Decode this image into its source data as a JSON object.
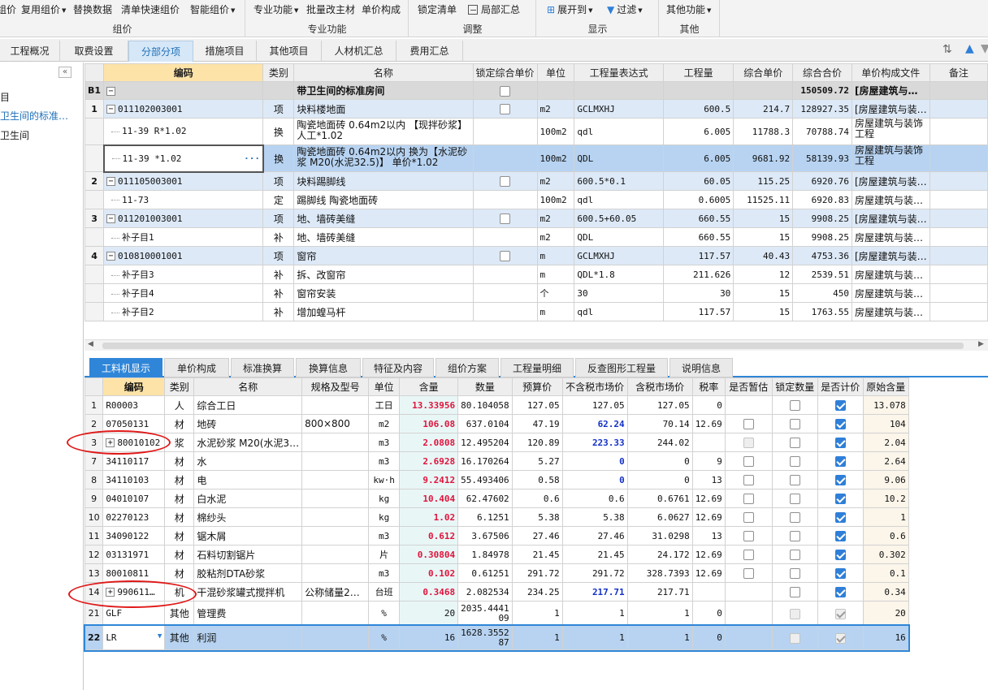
{
  "ribbon": {
    "btns": [
      "组价",
      "复用组价",
      "替换数据",
      "清单快速组价",
      "智能组价",
      "专业功能",
      "批量改主材",
      "单价构成",
      "锁定清单",
      "局部汇总",
      "展开到",
      "过滤",
      "其他功能"
    ],
    "groups": [
      "组价",
      "专业功能",
      "调整",
      "显示",
      "其他"
    ]
  },
  "tabs": [
    "工程概况",
    "取费设置",
    "分部分项",
    "措施项目",
    "其他项目",
    "人材机汇总",
    "费用汇总"
  ],
  "left": {
    "items": [
      "目",
      "卫生间的标准…",
      "卫生间"
    ]
  },
  "top": {
    "headers": [
      "编码",
      "类别",
      "名称",
      "锁定综合单价",
      "单位",
      "工程量表达式",
      "工程量",
      "综合单价",
      "综合合价",
      "单价构成文件",
      "备注"
    ],
    "rows": [
      {
        "no": "B1",
        "code": "",
        "type": "",
        "name": "带卫生间的标准房间",
        "lock": true,
        "unit": "",
        "expr": "",
        "qty": "",
        "price": "",
        "total": "150509.72",
        "file": "[房屋建筑与…"
      },
      {
        "no": "1",
        "code": "011102003001",
        "type": "项",
        "name": "块料楼地面",
        "lock": true,
        "unit": "m2",
        "expr": "GCLMXHJ",
        "qty": "600.5",
        "price": "214.7",
        "total": "128927.35",
        "file": "[房屋建筑与装…"
      },
      {
        "no": "",
        "code": "11-39 R*1.02",
        "type": "换",
        "name": "陶瓷地面砖 0.64m2以内 【现拌砂浆】 人工*1.02",
        "lock": false,
        "unit": "100m2",
        "expr": "qdl",
        "qty": "6.005",
        "price": "11788.3",
        "total": "70788.74",
        "file": "房屋建筑与装饰工程"
      },
      {
        "no": "",
        "code": "11-39 *1.02",
        "type": "换",
        "name": "陶瓷地面砖 0.64m2以内 换为【水泥砂浆 M20(水泥32.5)】 单价*1.02",
        "lock": false,
        "unit": "100m2",
        "expr": "QDL",
        "qty": "6.005",
        "price": "9681.92",
        "total": "58139.93",
        "file": "房屋建筑与装饰工程",
        "dots": "···"
      },
      {
        "no": "2",
        "code": "011105003001",
        "type": "项",
        "name": "块料踢脚线",
        "lock": true,
        "unit": "m2",
        "expr": "600.5*0.1",
        "qty": "60.05",
        "price": "115.25",
        "total": "6920.76",
        "file": "[房屋建筑与装…"
      },
      {
        "no": "",
        "code": "11-73",
        "type": "定",
        "name": "踢脚线 陶瓷地面砖",
        "lock": false,
        "unit": "100m2",
        "expr": "qdl",
        "qty": "0.6005",
        "price": "11525.11",
        "total": "6920.83",
        "file": "房屋建筑与装…"
      },
      {
        "no": "3",
        "code": "011201003001",
        "type": "项",
        "name": "地、墙砖美缝",
        "lock": true,
        "unit": "m2",
        "expr": "600.5+60.05",
        "qty": "660.55",
        "price": "15",
        "total": "9908.25",
        "file": "[房屋建筑与装…"
      },
      {
        "no": "",
        "code": "补子目1",
        "type": "补",
        "name": "地、墙砖美缝",
        "lock": false,
        "unit": "m2",
        "expr": "QDL",
        "qty": "660.55",
        "price": "15",
        "total": "9908.25",
        "file": "房屋建筑与装…"
      },
      {
        "no": "4",
        "code": "010810001001",
        "type": "项",
        "name": "窗帘",
        "lock": true,
        "unit": "m",
        "expr": "GCLMXHJ",
        "qty": "117.57",
        "price": "40.43",
        "total": "4753.36",
        "file": "[房屋建筑与装…"
      },
      {
        "no": "",
        "code": "补子目3",
        "type": "补",
        "name": "拆、改窗帘",
        "lock": false,
        "unit": "m",
        "expr": "QDL*1.8",
        "qty": "211.626",
        "price": "12",
        "total": "2539.51",
        "file": "房屋建筑与装…"
      },
      {
        "no": "",
        "code": "补子目4",
        "type": "补",
        "name": "窗帘安装",
        "lock": false,
        "unit": "个",
        "expr": "30",
        "qty": "30",
        "price": "15",
        "total": "450",
        "file": "房屋建筑与装…"
      },
      {
        "no": "",
        "code": "补子目2",
        "type": "补",
        "name": "增加蝗马杆",
        "lock": false,
        "unit": "m",
        "expr": "qdl",
        "qty": "117.57",
        "price": "15",
        "total": "1763.55",
        "file": "房屋建筑与装…"
      }
    ]
  },
  "btabs": [
    "工料机显示",
    "单价构成",
    "标准换算",
    "换算信息",
    "特征及内容",
    "组价方案",
    "工程量明细",
    "反查图形工程量",
    "说明信息"
  ],
  "bottom": {
    "headers": [
      "编码",
      "类别",
      "名称",
      "规格及型号",
      "单位",
      "含量",
      "数量",
      "预算价",
      "不含税市场价",
      "含税市场价",
      "税率",
      "是否暂估",
      "锁定数量",
      "是否计价",
      "原始含量"
    ],
    "rows": [
      {
        "no": "1",
        "code": "R00003",
        "type": "人",
        "name": "综合工日",
        "spec": "",
        "unit": "工日",
        "content": "13.33956",
        "qty": "80.104058",
        "budget": "127.05",
        "mkt": "127.05",
        "mkt_blue": false,
        "taxmkt": "127.05",
        "rate": "0",
        "est": "",
        "lockq": "off",
        "calc": "on",
        "orig": "13.078"
      },
      {
        "no": "2",
        "code": "07050131",
        "type": "材",
        "name": "地砖",
        "spec": "800×800",
        "unit": "m2",
        "content": "106.08",
        "qty": "637.0104",
        "budget": "47.19",
        "mkt": "62.24",
        "mkt_blue": true,
        "taxmkt": "70.14",
        "rate": "12.69",
        "est": "off",
        "lockq": "off",
        "calc": "on",
        "orig": "104"
      },
      {
        "no": "3",
        "code": "80010102",
        "type": "浆",
        "name": "水泥砂浆 M20(水泥3…",
        "spec": "",
        "unit": "m3",
        "content": "2.0808",
        "qty": "12.495204",
        "budget": "120.89",
        "mkt": "223.33",
        "mkt_blue": true,
        "taxmkt": "244.02",
        "rate": "",
        "est": "dis",
        "lockq": "off",
        "calc": "on",
        "orig": "2.04",
        "plus": "+"
      },
      {
        "no": "7",
        "code": "34110117",
        "type": "材",
        "name": "水",
        "spec": "",
        "unit": "m3",
        "content": "2.6928",
        "qty": "16.170264",
        "budget": "5.27",
        "mkt": "0",
        "mkt_blue": true,
        "taxmkt": "0",
        "rate": "9",
        "est": "off",
        "lockq": "off",
        "calc": "on",
        "orig": "2.64"
      },
      {
        "no": "8",
        "code": "34110103",
        "type": "材",
        "name": "电",
        "spec": "",
        "unit": "kw·h",
        "content": "9.2412",
        "qty": "55.493406",
        "budget": "0.58",
        "mkt": "0",
        "mkt_blue": true,
        "taxmkt": "0",
        "rate": "13",
        "est": "off",
        "lockq": "off",
        "calc": "on",
        "orig": "9.06"
      },
      {
        "no": "9",
        "code": "04010107",
        "type": "材",
        "name": "白水泥",
        "spec": "",
        "unit": "kg",
        "content": "10.404",
        "qty": "62.47602",
        "budget": "0.6",
        "mkt": "0.6",
        "mkt_blue": false,
        "taxmkt": "0.6761",
        "rate": "12.69",
        "est": "off",
        "lockq": "off",
        "calc": "on",
        "orig": "10.2"
      },
      {
        "no": "10",
        "code": "02270123",
        "type": "材",
        "name": "棉纱头",
        "spec": "",
        "unit": "kg",
        "content": "1.02",
        "qty": "6.1251",
        "budget": "5.38",
        "mkt": "5.38",
        "mkt_blue": false,
        "taxmkt": "6.0627",
        "rate": "12.69",
        "est": "off",
        "lockq": "off",
        "calc": "on",
        "orig": "1"
      },
      {
        "no": "11",
        "code": "34090122",
        "type": "材",
        "name": "锯木屑",
        "spec": "",
        "unit": "m3",
        "content": "0.612",
        "qty": "3.67506",
        "budget": "27.46",
        "mkt": "27.46",
        "mkt_blue": false,
        "taxmkt": "31.0298",
        "rate": "13",
        "est": "off",
        "lockq": "off",
        "calc": "on",
        "orig": "0.6"
      },
      {
        "no": "12",
        "code": "03131971",
        "type": "材",
        "name": "石料切割锯片",
        "spec": "",
        "unit": "片",
        "content": "0.30804",
        "qty": "1.84978",
        "budget": "21.45",
        "mkt": "21.45",
        "mkt_blue": false,
        "taxmkt": "24.172",
        "rate": "12.69",
        "est": "off",
        "lockq": "off",
        "calc": "on",
        "orig": "0.302"
      },
      {
        "no": "13",
        "code": "80010811",
        "type": "材",
        "name": "胶粘剂DTA砂浆",
        "spec": "",
        "unit": "m3",
        "content": "0.102",
        "qty": "0.61251",
        "budget": "291.72",
        "mkt": "291.72",
        "mkt_blue": false,
        "taxmkt": "328.7393",
        "rate": "12.69",
        "est": "off",
        "lockq": "off",
        "calc": "on",
        "orig": "0.1"
      },
      {
        "no": "14",
        "code": "990611…",
        "type": "机",
        "name": "干混砂浆罐式搅拌机",
        "spec": "公称储量2…",
        "unit": "台班",
        "content": "0.3468",
        "qty": "2.082534",
        "budget": "234.25",
        "mkt": "217.71",
        "mkt_blue": true,
        "taxmkt": "217.71",
        "rate": "",
        "est": "",
        "lockq": "off",
        "calc": "on",
        "orig": "0.34",
        "plus": "+"
      },
      {
        "no": "21",
        "code": "GLF",
        "type": "其他",
        "name": "管理费",
        "spec": "",
        "unit": "%",
        "content": "20",
        "content_plain": true,
        "qty": "2035.444109",
        "budget": "1",
        "mkt": "1",
        "mkt_blue": false,
        "taxmkt": "1",
        "rate": "0",
        "est": "",
        "lockq": "dis",
        "calc": "dison",
        "orig": "20"
      },
      {
        "no": "22",
        "code": "LR",
        "type": "其他",
        "name": "利润",
        "spec": "",
        "unit": "%",
        "content": "16",
        "content_plain": true,
        "qty": "1628.355287",
        "budget": "1",
        "mkt": "1",
        "mkt_blue": false,
        "taxmkt": "1",
        "rate": "0",
        "est": "",
        "lockq": "dis",
        "calc": "dison",
        "orig": "16",
        "selected": true
      }
    ]
  }
}
